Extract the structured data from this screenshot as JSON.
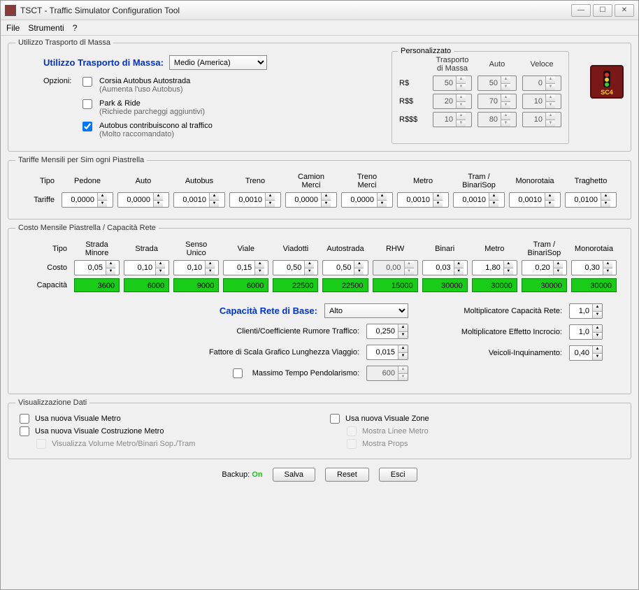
{
  "window": {
    "title": "TSCT - Traffic Simulator Configuration Tool"
  },
  "menu": {
    "file": "File",
    "tools": "Strumenti",
    "help": "?"
  },
  "sec1": {
    "legend": "Utilizzo Trasporto di Massa",
    "mainLabel": "Utilizzo Trasporto di Massa:",
    "selected": "Medio (America)",
    "optionsLabel": "Opzioni:",
    "opt1": "Corsia Autobus Autostrada",
    "opt1sub": "(Aumenta l'uso Autobus)",
    "opt2": "Park & Ride",
    "opt2sub": "(Richiede parcheggi aggiuntivi)",
    "opt3": "Autobus contribuiscono al traffico",
    "opt3sub": "(Molto raccomandato)",
    "custom": {
      "legend": "Personalizzato",
      "colMass": "Trasporto di Massa",
      "colAuto": "Auto",
      "colSpeed": "Veloce",
      "r1": "R$",
      "r2": "R$$",
      "r3": "R$$$",
      "v": [
        [
          "50",
          "50",
          "0"
        ],
        [
          "20",
          "70",
          "10"
        ],
        [
          "10",
          "80",
          "10"
        ]
      ]
    },
    "logo": "SC4"
  },
  "fares": {
    "legend": "Tariffe Mensili per Sim ogni Piastrella",
    "tipo": "Tipo",
    "tariffe": "Tariffe",
    "cols": [
      "Pedone",
      "Auto",
      "Autobus",
      "Treno",
      "Camion Merci",
      "Treno Merci",
      "Metro",
      "Tram / BinariSop",
      "Monorotaia",
      "Traghetto"
    ],
    "vals": [
      "0,0000",
      "0,0000",
      "0,0010",
      "0,0010",
      "0,0000",
      "0,0000",
      "0,0010",
      "0,0010",
      "0,0010",
      "0,0100"
    ]
  },
  "cost": {
    "legend": "Costo Mensile Piastrella / Capacità Rete",
    "tipo": "Tipo",
    "costo": "Costo",
    "capacita": "Capacità",
    "cols": [
      "Strada Minore",
      "Strada",
      "Senso Unico",
      "Viale",
      "Viadotti",
      "Autostrada",
      "RHW",
      "Binari",
      "Metro",
      "Tram / BinariSop",
      "Monorotaia"
    ],
    "costs": [
      "0,05",
      "0,10",
      "0,10",
      "0,15",
      "0,50",
      "0,50",
      "0,00",
      "0,03",
      "1,80",
      "0,20",
      "0,30"
    ],
    "caps": [
      "3600",
      "6000",
      "9000",
      "6000",
      "22500",
      "22500",
      "15000",
      "30000",
      "30000",
      "30000",
      "30000"
    ],
    "baseLabel": "Capacità Rete di Base:",
    "baseSel": "Alto",
    "noise": "Clienti/Coefficiente Rumore Traffico:",
    "noiseVal": "0,250",
    "scale": "Fattore di Scala Grafico Lunghezza Viaggio:",
    "scaleVal": "0,015",
    "maxCommute": "Massimo Tempo Pendolarismo:",
    "maxCommuteVal": "600",
    "mult1": "Moltiplicatore Capacità Rete:",
    "mult1v": "1,0",
    "mult2": "Moltiplicatore Effetto Incrocio:",
    "mult2v": "1,0",
    "mult3": "Veicoli-Inquinamento:",
    "mult3v": "0,40"
  },
  "viz": {
    "legend": "Visualizzazione Dati",
    "o1": "Usa nuova Visuale Metro",
    "o2": "Usa nuova Visuale Costruzione Metro",
    "o3": "Visualizza Volume Metro/Binari Sop./Tram",
    "o4": "Usa nuova Visuale Zone",
    "o5": "Mostra Linee Metro",
    "o6": "Mostra Props"
  },
  "footer": {
    "backup": "Backup:",
    "on": "On",
    "save": "Salva",
    "reset": "Reset",
    "exit": "Esci"
  }
}
